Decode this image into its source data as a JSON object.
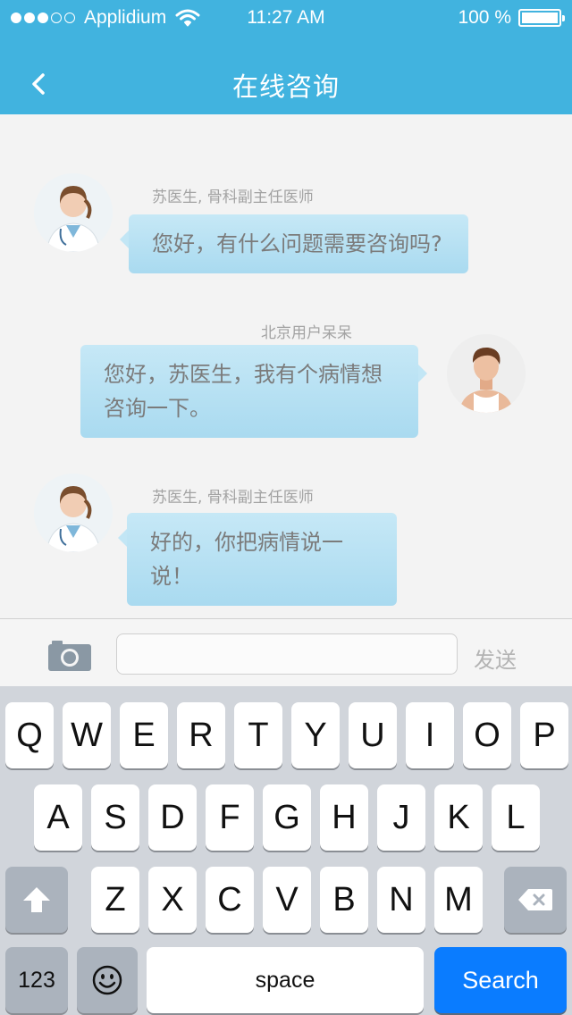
{
  "status_bar": {
    "carrier": "Applidium",
    "time": "11:27 AM",
    "battery": "100 %"
  },
  "nav": {
    "title": "在线咨询"
  },
  "messages": [
    {
      "side": "left",
      "sender": "苏医生, 骨科副主任医师",
      "lines": [
        "您好，有什么问题需要咨询吗?"
      ]
    },
    {
      "side": "right",
      "sender": "北京用户呆呆",
      "lines": [
        "您好，苏医生，我有个病情想",
        "咨询一下。"
      ]
    },
    {
      "side": "left",
      "sender": "苏医生, 骨科副主任医师",
      "lines": [
        "好的，你把病情说一说！"
      ]
    }
  ],
  "input": {
    "value": "",
    "send_label": "发送"
  },
  "keyboard": {
    "row1": [
      "Q",
      "W",
      "E",
      "R",
      "T",
      "Y",
      "U",
      "I",
      "O",
      "P"
    ],
    "row2": [
      "A",
      "S",
      "D",
      "F",
      "G",
      "H",
      "J",
      "K",
      "L"
    ],
    "row3": [
      "Z",
      "X",
      "C",
      "V",
      "B",
      "N",
      "M"
    ],
    "numbers_label": "123",
    "space_label": "space",
    "search_label": "Search"
  },
  "colors": {
    "header": "#41b3df",
    "bubble": "#b7e0f3",
    "search_key": "#0a7cff"
  }
}
